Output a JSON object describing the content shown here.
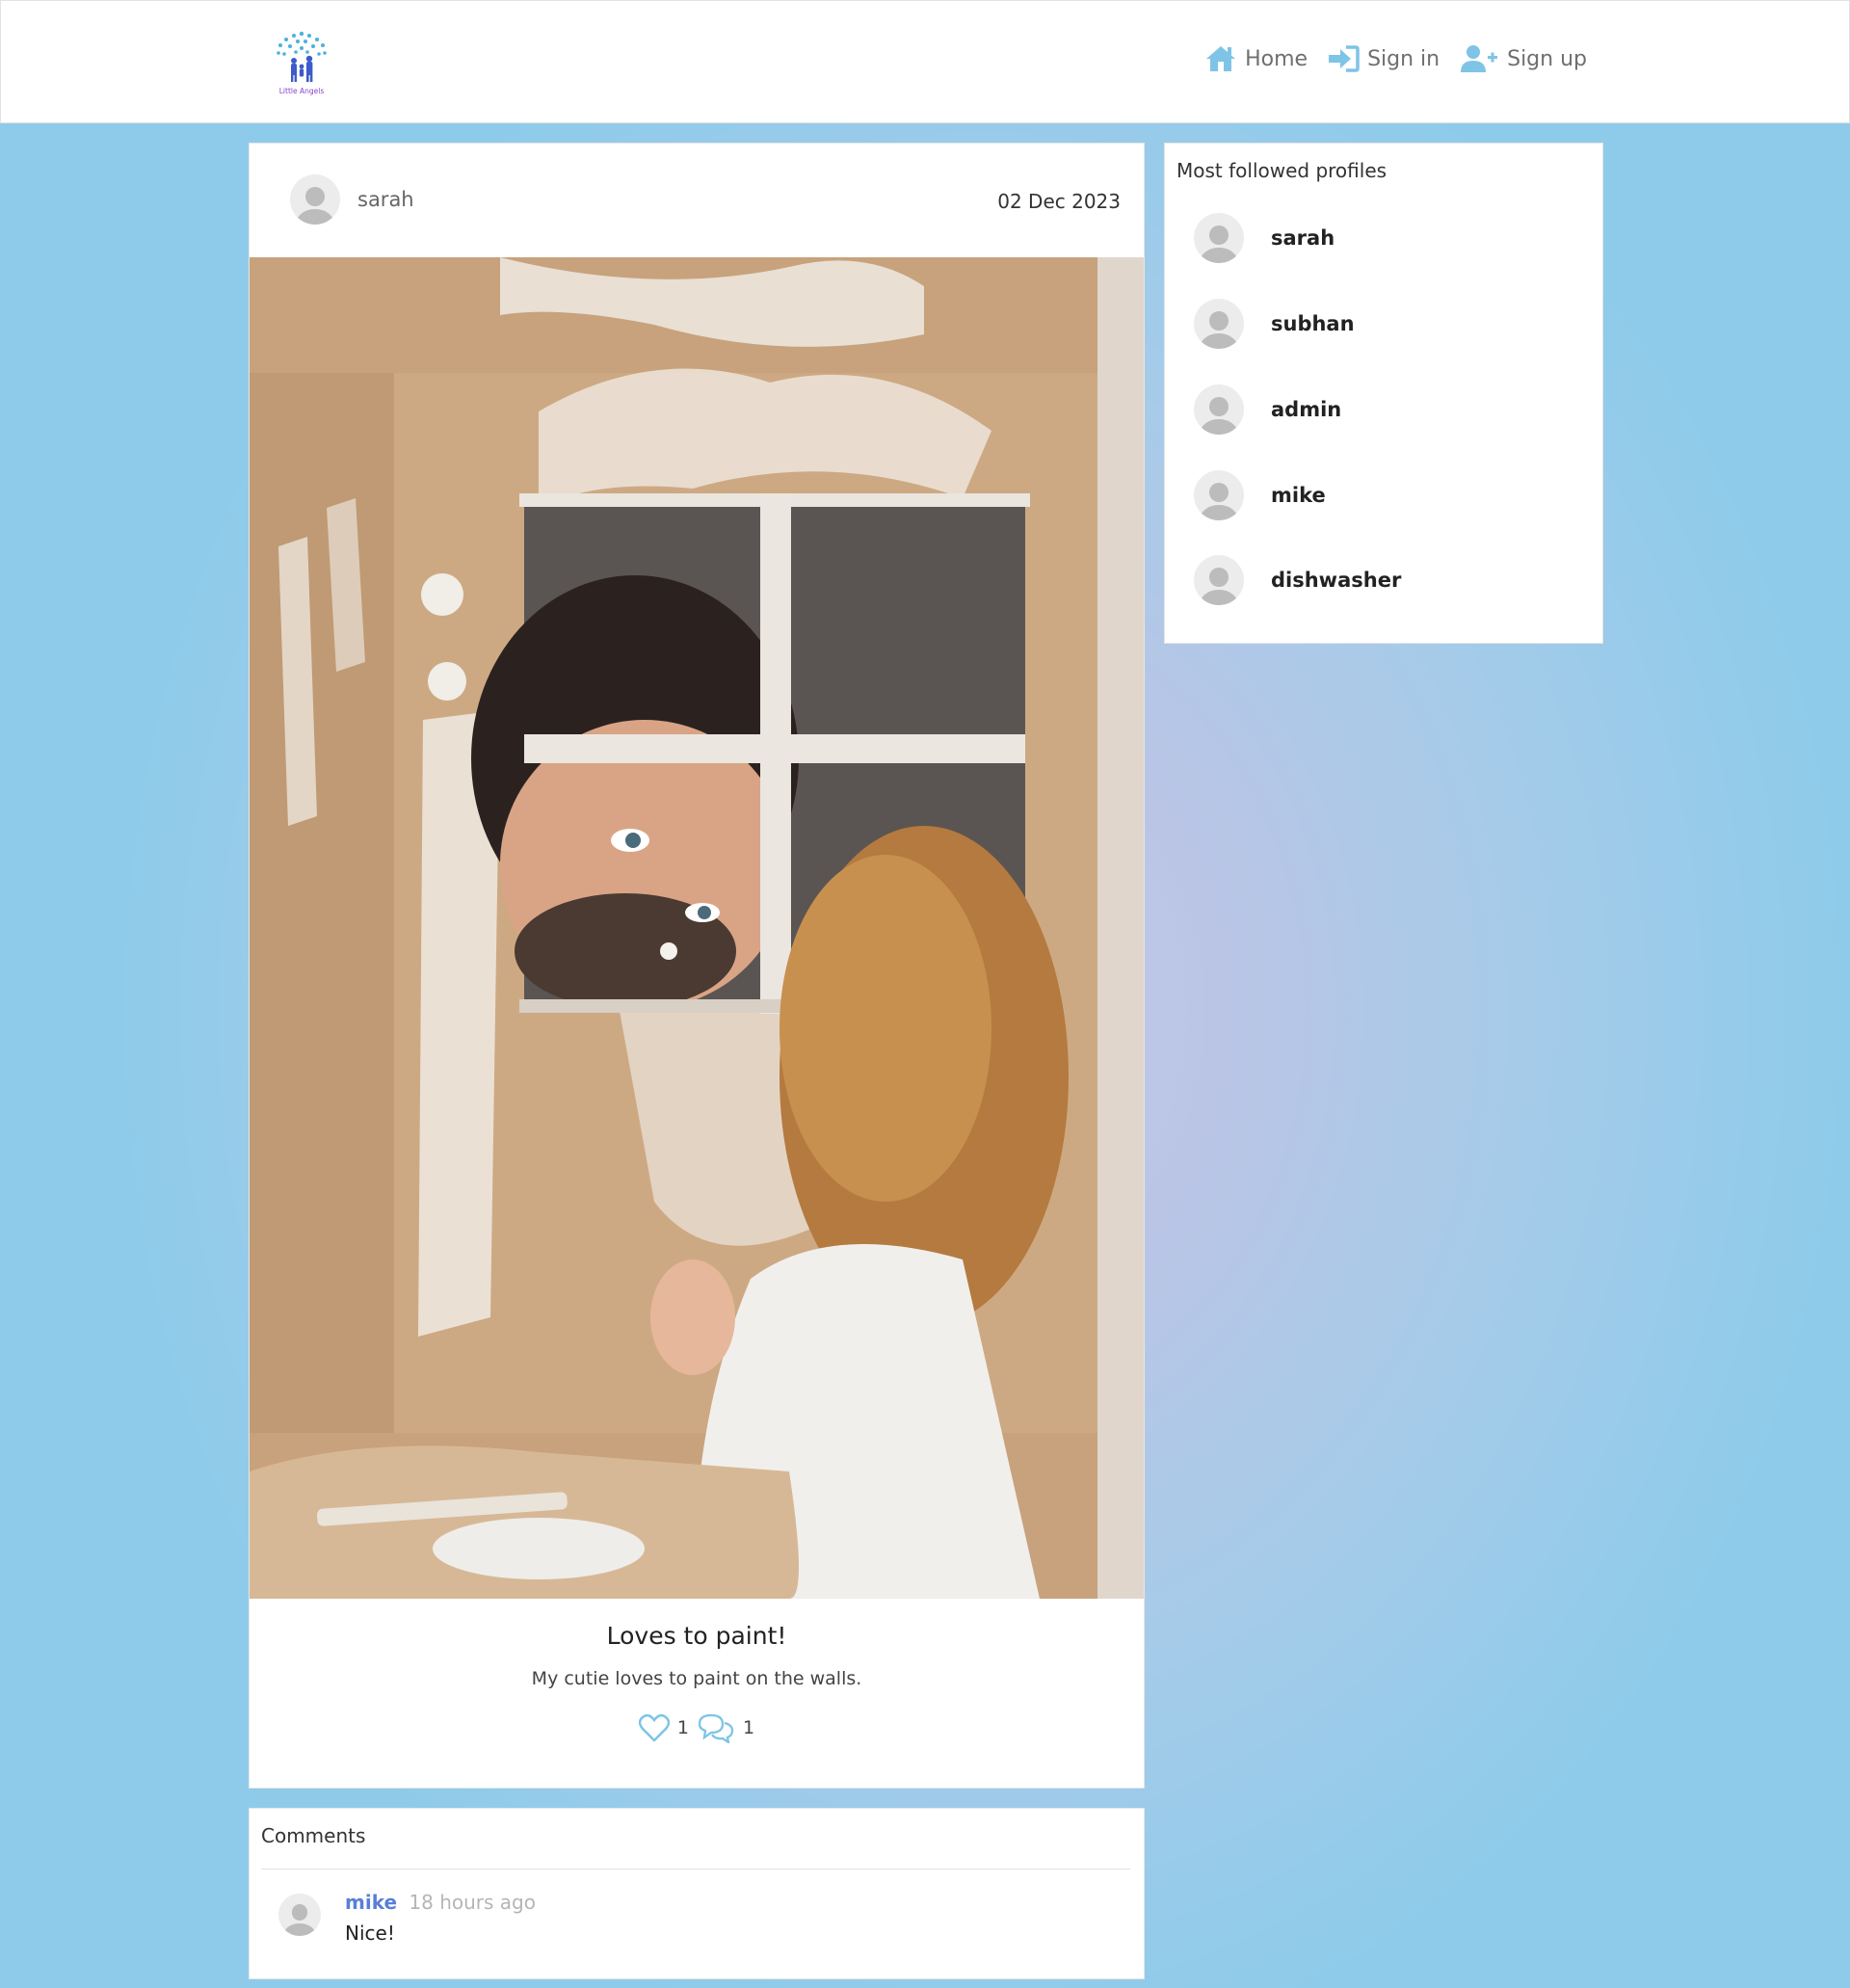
{
  "brand": {
    "logo_text": "Little Angels",
    "accent": "#7ec4e6"
  },
  "nav": {
    "home": "Home",
    "sign_in": "Sign in",
    "sign_up": "Sign up"
  },
  "post": {
    "author": "sarah",
    "date": "02 Dec 2023",
    "title": "Loves to paint!",
    "text": "My cutie loves to paint on the walls.",
    "likes": "1",
    "comments_count": "1"
  },
  "comments": {
    "title": "Comments",
    "items": [
      {
        "user": "mike",
        "time": "18 hours ago",
        "text": "Nice!"
      }
    ]
  },
  "sidebar": {
    "title": "Most followed profiles",
    "profiles": [
      {
        "name": "sarah"
      },
      {
        "name": "subhan"
      },
      {
        "name": "admin"
      },
      {
        "name": "mike"
      },
      {
        "name": "dishwasher"
      }
    ]
  }
}
